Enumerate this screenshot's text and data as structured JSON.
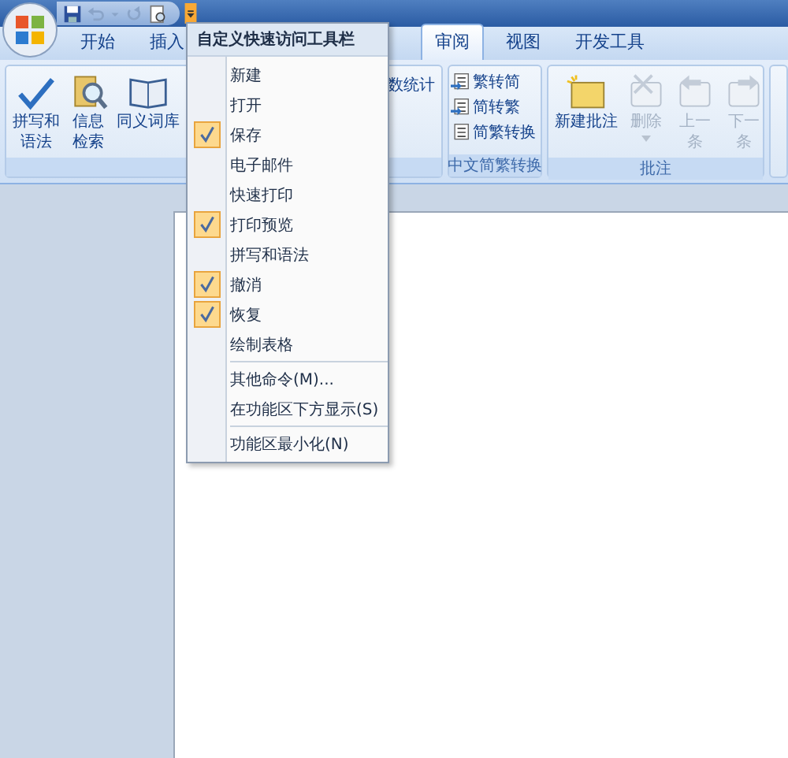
{
  "tabs": [
    {
      "label": "开始",
      "selected": false
    },
    {
      "label": "插入",
      "selected": false
    },
    {
      "label": "审阅",
      "selected": true
    },
    {
      "label": "视图",
      "selected": false
    },
    {
      "label": "开发工具",
      "selected": false
    }
  ],
  "ribbon": {
    "groups": [
      {
        "buttons": [
          {
            "kind": "large",
            "lines": [
              "拼写和",
              "语法"
            ],
            "disabled": false
          },
          {
            "kind": "large",
            "lines": [
              "信息",
              "检索"
            ],
            "disabled": false
          },
          {
            "kind": "large",
            "lines": [
              "同义词库"
            ],
            "disabled": false
          }
        ],
        "side_text": "数统计"
      },
      {
        "title": "中文简繁转换",
        "buttons": [
          {
            "kind": "small",
            "lines": [
              "繁转简"
            ],
            "disabled": false
          },
          {
            "kind": "small",
            "lines": [
              "简转繁"
            ],
            "disabled": false
          },
          {
            "kind": "small",
            "lines": [
              "简繁转换"
            ],
            "disabled": false
          }
        ]
      },
      {
        "title": "批注",
        "buttons": [
          {
            "kind": "large",
            "lines": [
              "新建批注"
            ],
            "disabled": false
          },
          {
            "kind": "large",
            "lines": [
              "删除"
            ],
            "disabled": true,
            "dropdown": true
          },
          {
            "kind": "large",
            "lines": [
              "上一",
              "条"
            ],
            "disabled": true
          },
          {
            "kind": "large",
            "lines": [
              "下一",
              "条"
            ],
            "disabled": true
          }
        ]
      }
    ]
  },
  "menu": {
    "title": "自定义快速访问工具栏",
    "sections": [
      [
        {
          "label": "新建",
          "checked": false
        },
        {
          "label": "打开",
          "checked": false
        },
        {
          "label": "保存",
          "checked": true
        },
        {
          "label": "电子邮件",
          "checked": false
        },
        {
          "label": "快速打印",
          "checked": false
        },
        {
          "label": "打印预览",
          "checked": true
        },
        {
          "label": "拼写和语法",
          "checked": false
        },
        {
          "label": "撤消",
          "checked": true
        },
        {
          "label": "恢复",
          "checked": true
        },
        {
          "label": "绘制表格",
          "checked": false
        }
      ],
      [
        {
          "label": "其他命令(M)...",
          "checked": false
        },
        {
          "label": "在功能区下方显示(S)",
          "checked": false
        }
      ],
      [
        {
          "label": "功能区最小化(N)",
          "checked": false
        }
      ]
    ]
  }
}
